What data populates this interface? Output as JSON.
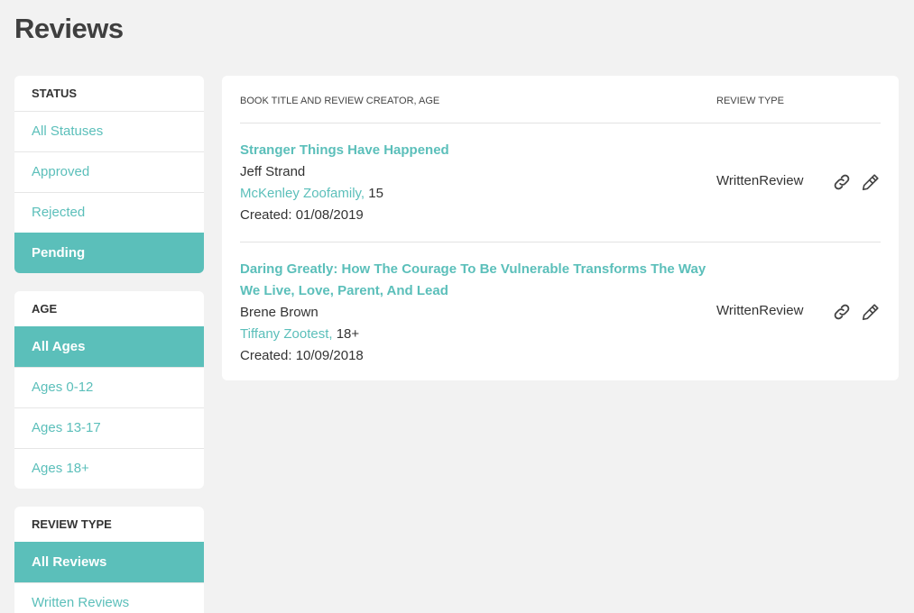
{
  "page": {
    "title": "Reviews"
  },
  "filters": {
    "status": {
      "heading": "STATUS",
      "items": [
        {
          "label": "All Statuses",
          "active": false
        },
        {
          "label": "Approved",
          "active": false
        },
        {
          "label": "Rejected",
          "active": false
        },
        {
          "label": "Pending",
          "active": true
        }
      ]
    },
    "age": {
      "heading": "AGE",
      "items": [
        {
          "label": "All Ages",
          "active": true
        },
        {
          "label": "Ages 0-12",
          "active": false
        },
        {
          "label": "Ages 13-17",
          "active": false
        },
        {
          "label": "Ages 18+",
          "active": false
        }
      ]
    },
    "review_type": {
      "heading": "REVIEW TYPE",
      "items": [
        {
          "label": "All Reviews",
          "active": true
        },
        {
          "label": "Written Reviews",
          "active": false
        }
      ]
    }
  },
  "table": {
    "columns": {
      "title": "BOOK TITLE AND REVIEW CREATOR, AGE",
      "type": "REVIEW TYPE"
    },
    "rows": [
      {
        "book_title": "Stranger Things Have Happened",
        "author": "Jeff Strand",
        "creator": "McKenley Zoofamily,",
        "age": "15",
        "created": "Created: 01/08/2019",
        "review_type": "WrittenReview"
      },
      {
        "book_title": "Daring Greatly: How The Courage To Be Vulnerable Transforms The Way We Live, Love, Parent, And Lead",
        "author": "Brene Brown",
        "creator": "Tiffany Zootest,",
        "age": "18+",
        "created": "Created: 10/09/2018",
        "review_type": "WrittenReview"
      }
    ]
  },
  "icons": {
    "link": "link-icon",
    "edit": "pencil-icon"
  },
  "colors": {
    "accent": "#5bbfba",
    "background": "#f2f2f2",
    "text": "#333333"
  }
}
